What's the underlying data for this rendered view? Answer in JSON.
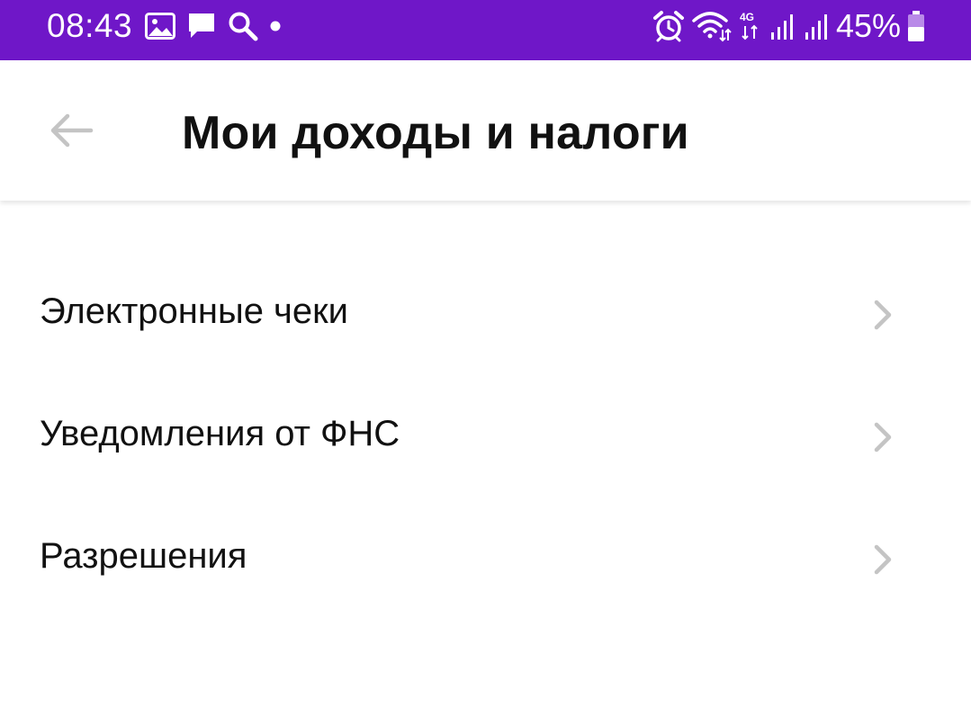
{
  "status_bar": {
    "time": "08:43",
    "battery_percent": "45%",
    "network_label": "4G",
    "background_color": "#6f17c8",
    "left_icons": [
      "image-icon",
      "message-icon",
      "search-icon",
      "dot-icon"
    ],
    "right_icons": [
      "alarm-icon",
      "wifi-icon",
      "network-4g-icon",
      "signal-icon",
      "signal-icon",
      "battery-icon"
    ]
  },
  "toolbar": {
    "title": "Мои доходы и налоги",
    "back_icon": "arrow-left-icon"
  },
  "menu": {
    "items": [
      {
        "label": "Электронные чеки",
        "icon": "chevron-right-icon"
      },
      {
        "label": "Уведомления от ФНС",
        "icon": "chevron-right-icon"
      },
      {
        "label": "Разрешения",
        "icon": "chevron-right-icon"
      }
    ]
  }
}
